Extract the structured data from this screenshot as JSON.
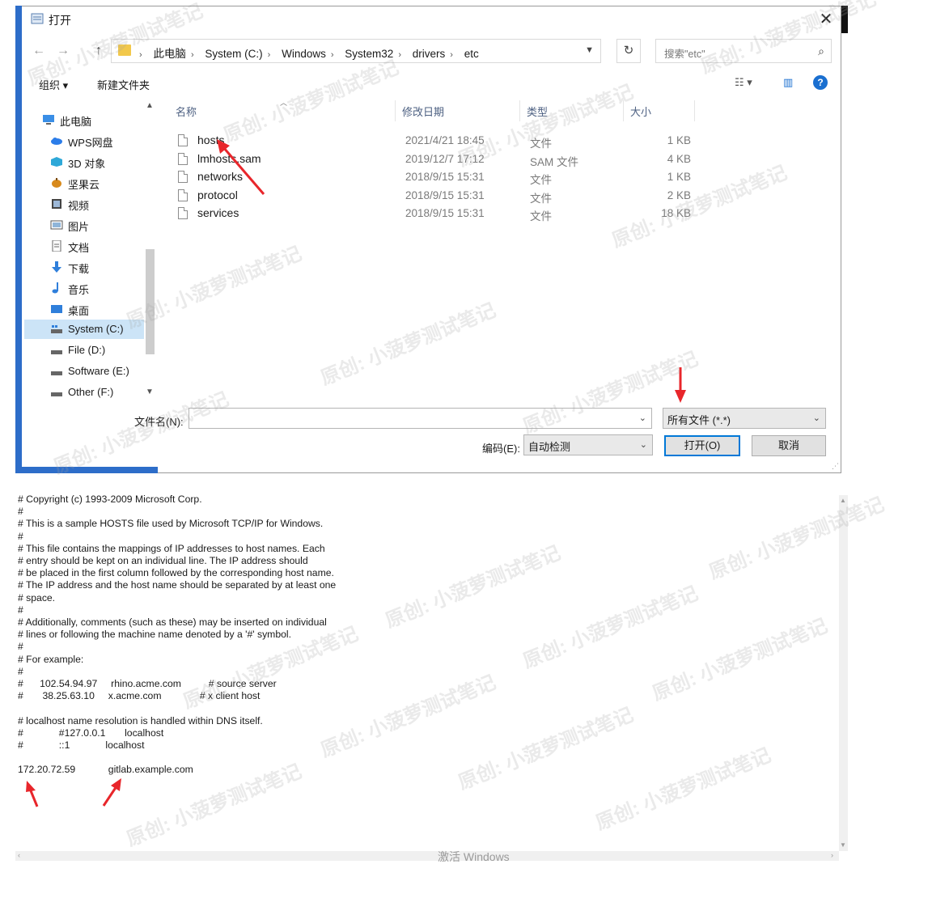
{
  "dialog": {
    "title": "打开",
    "breadcrumbs": [
      "此电脑",
      "System (C:)",
      "Windows",
      "System32",
      "drivers",
      "etc"
    ],
    "search_placeholder": "搜索\"etc\"",
    "toolbar": {
      "organize": "组织 ▾",
      "new_folder": "新建文件夹"
    },
    "sidebar": [
      {
        "label": "此电脑",
        "icon": "computer-icon",
        "selected": false
      },
      {
        "label": "WPS网盘",
        "icon": "cloud-icon",
        "selected": false
      },
      {
        "label": "3D 对象",
        "icon": "cube-icon",
        "selected": false
      },
      {
        "label": "坚果云",
        "icon": "nut-icon",
        "selected": false
      },
      {
        "label": "视频",
        "icon": "video-icon",
        "selected": false
      },
      {
        "label": "图片",
        "icon": "picture-icon",
        "selected": false
      },
      {
        "label": "文档",
        "icon": "document-icon",
        "selected": false
      },
      {
        "label": "下载",
        "icon": "download-icon",
        "selected": false
      },
      {
        "label": "音乐",
        "icon": "music-icon",
        "selected": false
      },
      {
        "label": "桌面",
        "icon": "desktop-icon",
        "selected": false
      },
      {
        "label": "System (C:)",
        "icon": "drive-icon",
        "selected": true
      },
      {
        "label": "File (D:)",
        "icon": "drive-icon",
        "selected": false
      },
      {
        "label": "Software (E:)",
        "icon": "drive-icon",
        "selected": false
      },
      {
        "label": "Other (F:)",
        "icon": "drive-icon",
        "selected": false
      }
    ],
    "columns": {
      "name": "名称",
      "date": "修改日期",
      "type": "类型",
      "size": "大小"
    },
    "files": [
      {
        "name": "hosts",
        "date": "2021/4/21 18:45",
        "type": "文件",
        "size": "1 KB"
      },
      {
        "name": "lmhosts.sam",
        "date": "2019/12/7 17:12",
        "type": "SAM 文件",
        "size": "4 KB"
      },
      {
        "name": "networks",
        "date": "2018/9/15 15:31",
        "type": "文件",
        "size": "1 KB"
      },
      {
        "name": "protocol",
        "date": "2018/9/15 15:31",
        "type": "文件",
        "size": "2 KB"
      },
      {
        "name": "services",
        "date": "2018/9/15 15:31",
        "type": "文件",
        "size": "18 KB"
      }
    ],
    "filename_label": "文件名(N):",
    "filename_value": "",
    "filetype_value": "所有文件  (*.*)",
    "encoding_label": "编码(E):",
    "encoding_value": "自动检测",
    "open_button": "打开(O)",
    "cancel_button": "取消"
  },
  "notepad": {
    "lines": [
      "# Copyright (c) 1993-2009 Microsoft Corp.",
      "#",
      "# This is a sample HOSTS file used by Microsoft TCP/IP for Windows.",
      "#",
      "# This file contains the mappings of IP addresses to host names. Each",
      "# entry should be kept on an individual line. The IP address should",
      "# be placed in the first column followed by the corresponding host name.",
      "# The IP address and the host name should be separated by at least one",
      "# space.",
      "#",
      "# Additionally, comments (such as these) may be inserted on individual",
      "# lines or following the machine name denoted by a '#' symbol.",
      "#",
      "# For example:",
      "#",
      "#      102.54.94.97     rhino.acme.com          # source server",
      "#       38.25.63.10     x.acme.com              # x client host",
      "",
      "# localhost name resolution is handled within DNS itself.",
      "#             #127.0.0.1       localhost",
      "#             ::1             localhost",
      "",
      "172.20.72.59            gitlab.example.com"
    ],
    "status_watermark": "激活 Windows"
  },
  "watermark_text": "原创: 小菠萝测试笔记",
  "colors": {
    "accent": "#0078d7",
    "arrow": "#e8262b",
    "selected": "#cce4f7",
    "edge": "#2d6dc9"
  }
}
